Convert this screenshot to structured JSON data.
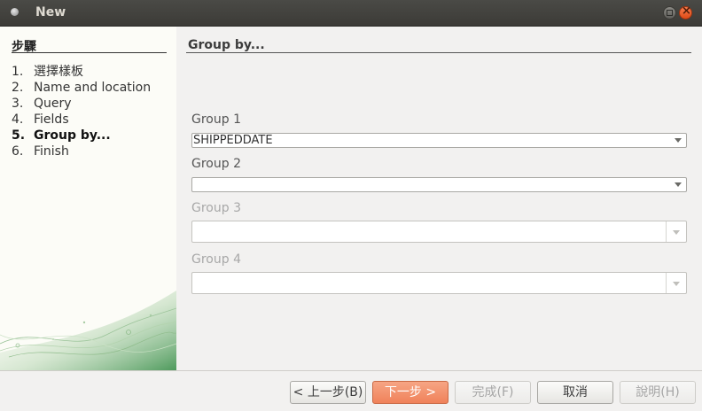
{
  "window": {
    "title": "New"
  },
  "steps": {
    "header": "步驟",
    "items": [
      {
        "num": "1.",
        "label": "選擇樣板"
      },
      {
        "num": "2.",
        "label": "Name and location"
      },
      {
        "num": "3.",
        "label": "Query"
      },
      {
        "num": "4.",
        "label": "Fields"
      },
      {
        "num": "5.",
        "label": "Group by..."
      },
      {
        "num": "6.",
        "label": "Finish"
      }
    ],
    "current_index": 4
  },
  "main": {
    "title": "Group by...",
    "groups": [
      {
        "label": "Group 1",
        "value": "SHIPPEDDATE",
        "enabled": true
      },
      {
        "label": "Group 2",
        "value": "",
        "enabled": true
      },
      {
        "label": "Group 3",
        "value": "",
        "enabled": false
      },
      {
        "label": "Group 4",
        "value": "",
        "enabled": false
      }
    ]
  },
  "buttons": {
    "back": "< 上一步(B)",
    "next": "下一步 >",
    "finish": "完成(F)",
    "cancel": "取消",
    "help": "說明(H)"
  },
  "colors": {
    "titlebar": "#3c3b37",
    "primary_button": "#f0825a",
    "steps_background": "#fcfcf7",
    "decoration_green": "#4e9a5c"
  }
}
